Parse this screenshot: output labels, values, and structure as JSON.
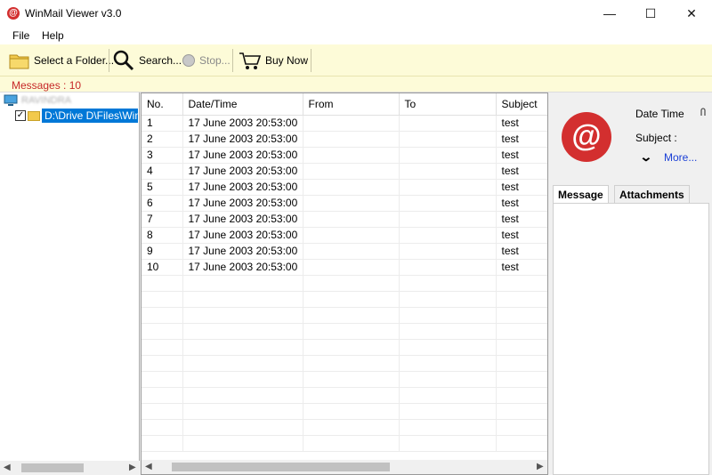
{
  "window": {
    "title": "WinMail Viewer v3.0",
    "icon": "envelope-at-icon"
  },
  "window_controls": {
    "minimize": "—",
    "maximize": "☐",
    "close": "✕"
  },
  "menu": {
    "file": "File",
    "help": "Help"
  },
  "toolbar": {
    "select_folder": "Select a Folder...",
    "search": "Search...",
    "stop": "Stop...",
    "buy_now": "Buy Now"
  },
  "status": {
    "messages": "Messages : 10"
  },
  "tree": {
    "root_label": "RAVINDRA",
    "child_label": "D:\\Drive D\\Files\\WinMail"
  },
  "table": {
    "headers": [
      "No.",
      "Date/Time",
      "From",
      "To",
      "Subject"
    ],
    "rows": [
      [
        "1",
        "17 June 2003 20:53:00",
        "",
        "",
        "test"
      ],
      [
        "2",
        "17 June 2003 20:53:00",
        "",
        "",
        "test"
      ],
      [
        "3",
        "17 June 2003 20:53:00",
        "",
        "",
        "test"
      ],
      [
        "4",
        "17 June 2003 20:53:00",
        "",
        "",
        "test"
      ],
      [
        "5",
        "17 June 2003 20:53:00",
        "",
        "",
        "test"
      ],
      [
        "6",
        "17 June 2003 20:53:00",
        "",
        "",
        "test"
      ],
      [
        "7",
        "17 June 2003 20:53:00",
        "",
        "",
        "test"
      ],
      [
        "8",
        "17 June 2003 20:53:00",
        "",
        "",
        "test"
      ],
      [
        "9",
        "17 June 2003 20:53:00",
        "",
        "",
        "test"
      ],
      [
        "10",
        "17 June 2003 20:53:00",
        "",
        "",
        "test"
      ]
    ]
  },
  "preview": {
    "date_time": "Date Time",
    "subject": "Subject :",
    "more": "More...",
    "tab_message": "Message",
    "tab_attachments": "Attachments"
  },
  "colors": {
    "accent": "#d32f2f",
    "selection": "#0078d7",
    "toolbar_bg": "#fdfbd8"
  }
}
